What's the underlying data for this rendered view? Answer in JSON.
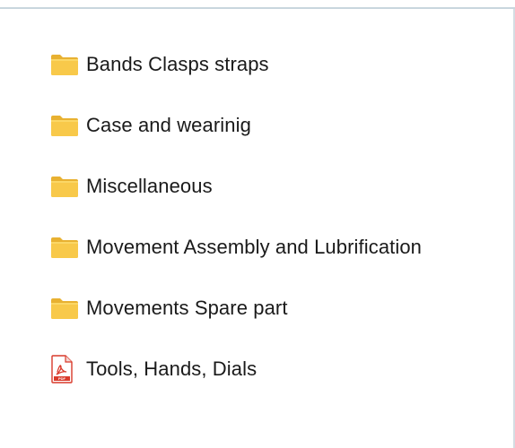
{
  "items": [
    {
      "label": "Bands Clasps straps",
      "icon": "folder-icon",
      "type": "folder"
    },
    {
      "label": "Case and wearinig",
      "icon": "folder-icon",
      "type": "folder"
    },
    {
      "label": "Miscellaneous",
      "icon": "folder-icon",
      "type": "folder"
    },
    {
      "label": "Movement Assembly and Lubrification",
      "icon": "folder-icon",
      "type": "folder"
    },
    {
      "label": "Movements Spare part",
      "icon": "folder-icon",
      "type": "folder"
    },
    {
      "label": "Tools, Hands, Dials",
      "icon": "pdf-icon",
      "type": "pdf"
    }
  ],
  "colors": {
    "folder_body": "#f8c94a",
    "folder_tab": "#e8b131",
    "pdf_red": "#d93a2b",
    "text": "#1a1a1a"
  }
}
